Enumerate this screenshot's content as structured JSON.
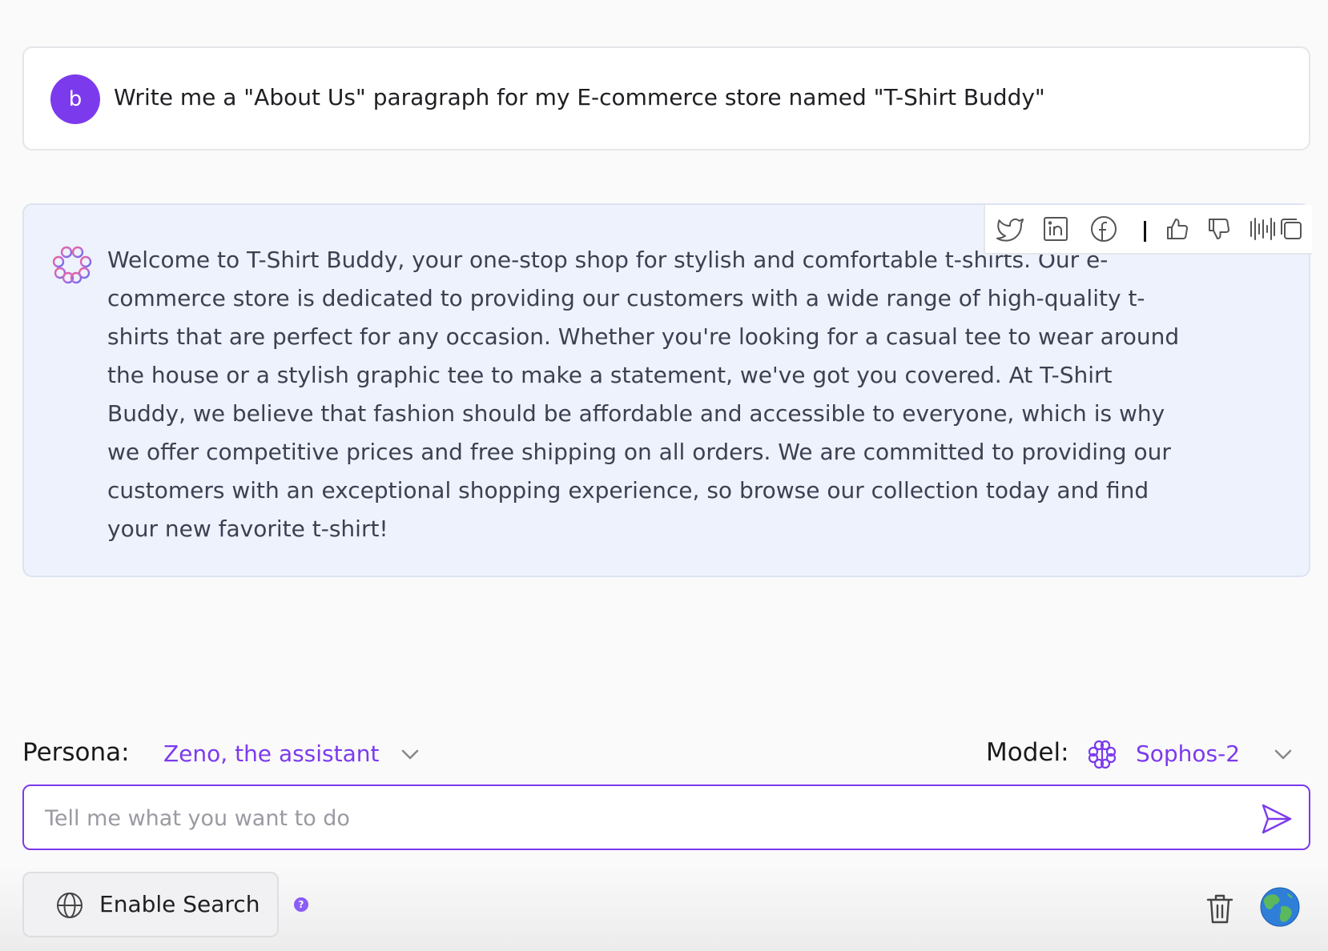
{
  "user_message": {
    "avatar_letter": "b",
    "text": "Write me a \"About Us\" paragraph for my E-commerce store named \"T-Shirt Buddy\""
  },
  "assistant_message": {
    "text": "Welcome to T-Shirt Buddy, your one-stop shop for stylish and comfortable t-shirts. Our e-commerce store is dedicated to providing our customers with a wide range of high-quality t-shirts that are perfect for any occasion. Whether you're looking for a casual tee to wear around the house or a stylish graphic tee to make a statement, we've got you covered. At T-Shirt Buddy, we believe that fashion should be affordable and accessible to everyone, which is why we offer competitive prices and free shipping on all orders. We are committed to providing our customers with an exceptional shopping experience, so browse our collection today and find your new favorite t-shirt!",
    "actions": [
      "twitter-icon",
      "linkedin-icon",
      "facebook-icon",
      "thumbs-up-icon",
      "thumbs-down-icon",
      "audio-waveform-icon",
      "copy-icon"
    ]
  },
  "persona": {
    "label": "Persona:",
    "value": "Zeno, the assistant"
  },
  "model": {
    "label": "Model:",
    "value": "Sophos-2"
  },
  "input": {
    "placeholder": "Tell me what you want to do"
  },
  "footer": {
    "search_label": "Enable Search",
    "help_symbol": "?"
  },
  "colors": {
    "accent": "#7c3aed",
    "assistant_bg": "#eef2fc",
    "user_card_bg": "#ffffff"
  }
}
